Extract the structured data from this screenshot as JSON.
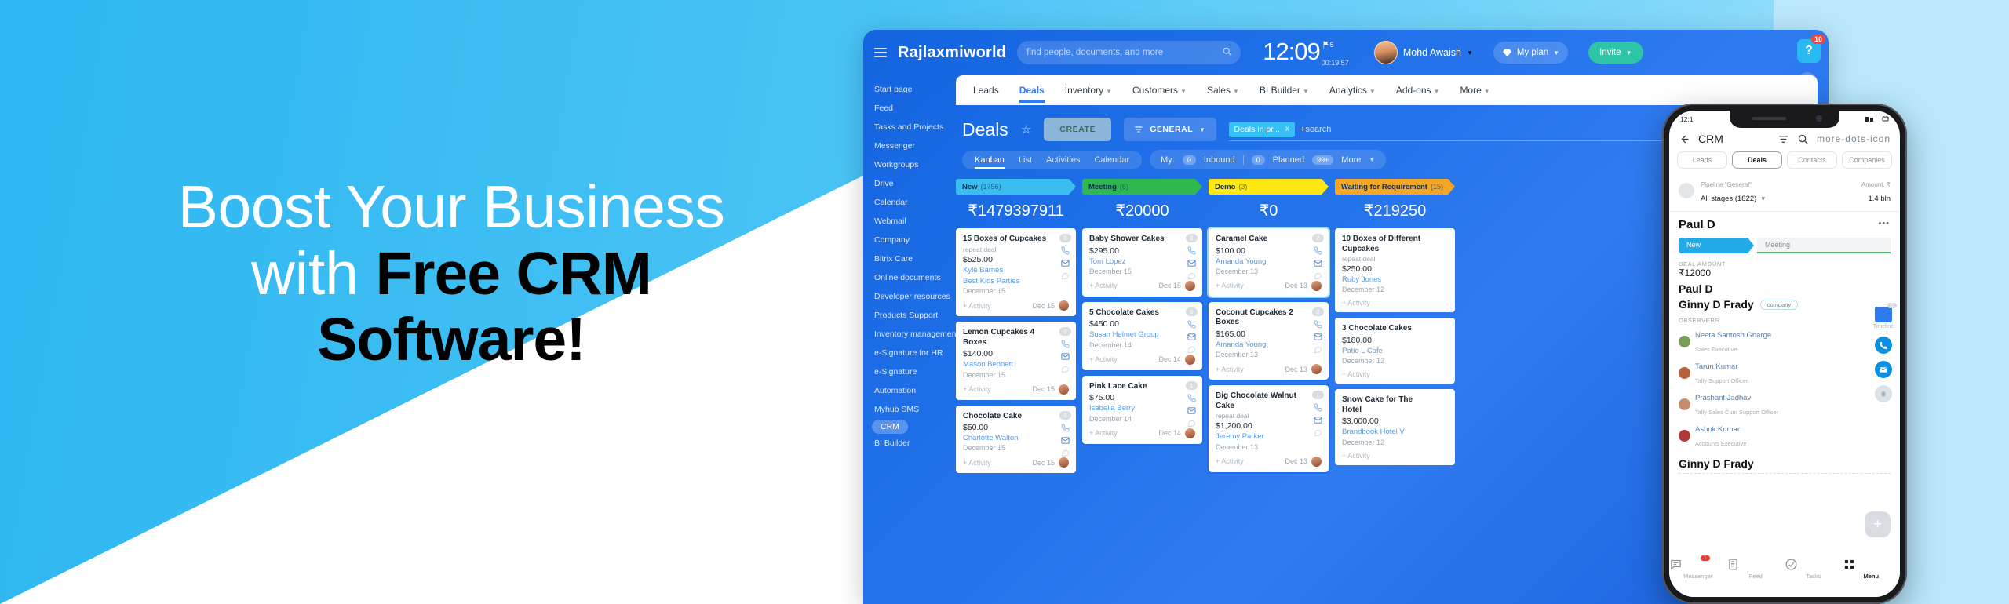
{
  "hero": {
    "line1": "Boost Your Business",
    "line2_light": "with ",
    "line2_bold": "Free CRM",
    "line3_bold": "Software!"
  },
  "app": {
    "topbar": {
      "menu_icon": "hamburger-icon",
      "brand": "Rajlaxmiworld",
      "search_placeholder": "find people, documents, and more",
      "search_icon": "search-icon",
      "clock": "12:09",
      "flag_count": "5",
      "stopwatch": "00:19:57",
      "user_name": "Mohd Awaish",
      "my_plan": "My plan",
      "invite": "Invite",
      "help_icon": "question-mark-icon",
      "help_badge": "10",
      "refresh_icon": "refresh-icon"
    },
    "sidebar": [
      {
        "label": "Start page",
        "active": false
      },
      {
        "label": "Feed",
        "active": false
      },
      {
        "label": "Tasks and Projects",
        "active": false
      },
      {
        "label": "Messenger",
        "active": false
      },
      {
        "label": "Workgroups",
        "active": false
      },
      {
        "label": "Drive",
        "active": false
      },
      {
        "label": "Calendar",
        "active": false
      },
      {
        "label": "Webmail",
        "active": false
      },
      {
        "label": "Company",
        "active": false
      },
      {
        "label": "Bitrix Care",
        "active": false
      },
      {
        "label": "Online documents",
        "active": false
      },
      {
        "label": "Developer resources",
        "active": false
      },
      {
        "label": "Products Support",
        "active": false
      },
      {
        "label": "Inventory management",
        "active": false
      },
      {
        "label": "e-Signature for HR",
        "active": false
      },
      {
        "label": "e-Signature",
        "active": false
      },
      {
        "label": "Automation",
        "active": false
      },
      {
        "label": "Myhub SMS",
        "active": false
      },
      {
        "label": "CRM",
        "active": true
      },
      {
        "label": "BI Builder",
        "active": false
      }
    ],
    "nav": [
      {
        "label": "Leads",
        "caret": false,
        "selected": false
      },
      {
        "label": "Deals",
        "caret": false,
        "selected": true
      },
      {
        "label": "Inventory",
        "caret": true,
        "selected": false
      },
      {
        "label": "Customers",
        "caret": true,
        "selected": false
      },
      {
        "label": "Sales",
        "caret": true,
        "selected": false
      },
      {
        "label": "BI Builder",
        "caret": true,
        "selected": false
      },
      {
        "label": "Analytics",
        "caret": true,
        "selected": false
      },
      {
        "label": "Add-ons",
        "caret": true,
        "selected": false
      },
      {
        "label": "More",
        "caret": true,
        "selected": false
      }
    ],
    "deals_toolbar": {
      "title": "Deals",
      "star_icon": "star-icon",
      "create": "CREATE",
      "filter_icon": "filter-icon",
      "general": "GENERAL",
      "chip": "Deals in pr...",
      "chip_close": "x",
      "plus": "+",
      "search_placeholder": "search"
    },
    "view_tabs": [
      {
        "label": "Kanban",
        "selected": true
      },
      {
        "label": "List",
        "selected": false
      },
      {
        "label": "Activities",
        "selected": false
      },
      {
        "label": "Calendar",
        "selected": false
      }
    ],
    "counters": {
      "my_label": "My:",
      "inbound_count": "0",
      "inbound_label": "Inbound",
      "planned_count": "0",
      "planned_label": "Planned",
      "more_count": "99+",
      "more_label": "More"
    },
    "kanban": [
      {
        "stage": "New",
        "count": "(1756)",
        "color": "#3bbdf0",
        "sum": "₹1479397911",
        "cards": [
          {
            "title": "15 Boxes of Cupcakes",
            "sub": "repeat deal",
            "amount": "$525.00",
            "person": "Kyle Barnes",
            "company": "Best Kids Parties",
            "date": "December 15",
            "activity": "+ Activity",
            "foot_date": "Dec 15",
            "badge": "0",
            "selected": false
          },
          {
            "title": "Lemon Cupcakes 4 Boxes",
            "sub": "",
            "amount": "$140.00",
            "person": "Mason Bennett",
            "company": "",
            "date": "December 15",
            "activity": "+ Activity",
            "foot_date": "Dec 15",
            "badge": "0",
            "selected": false
          },
          {
            "title": "Chocolate Cake",
            "sub": "",
            "amount": "$50.00",
            "person": "Charlotte Walton",
            "company": "",
            "date": "December 15",
            "activity": "+ Activity",
            "foot_date": "Dec 15",
            "badge": "0",
            "selected": false
          }
        ]
      },
      {
        "stage": "Meeting",
        "count": "(6)",
        "color": "#2eb84f",
        "sum": "₹20000",
        "cards": [
          {
            "title": "Baby Shower Cakes",
            "sub": "",
            "amount": "$295.00",
            "person": "Tom Lopez",
            "company": "",
            "date": "December 15",
            "activity": "+ Activity",
            "foot_date": "Dec 15",
            "badge": "0",
            "selected": false
          },
          {
            "title": "5 Chocolate Cakes",
            "sub": "",
            "amount": "$450.00",
            "person": "Susan Helmet Group",
            "company": "",
            "date": "December 14",
            "activity": "+ Activity",
            "foot_date": "Dec 14",
            "badge": "0",
            "selected": true
          },
          {
            "title": "Pink Lace Cake",
            "sub": "",
            "amount": "$75.00",
            "person": "Isabella Berry",
            "company": "",
            "date": "December 14",
            "activity": "+ Activity",
            "foot_date": "Dec 14",
            "badge": "1",
            "selected": true
          }
        ]
      },
      {
        "stage": "Demo",
        "count": "(3)",
        "color": "#ffe712",
        "sum": "₹0",
        "cards": [
          {
            "title": "Caramel Cake",
            "sub": "",
            "amount": "$100.00",
            "person": "Amanda Young",
            "company": "",
            "date": "December 13",
            "activity": "+ Activity",
            "foot_date": "Dec 13",
            "badge": "2",
            "selected": false
          },
          {
            "title": "Coconut Cupcakes 2 Boxes",
            "sub": "",
            "amount": "$165.00",
            "person": "Amanda Young",
            "company": "",
            "date": "December 13",
            "activity": "+ Activity",
            "foot_date": "Dec 13",
            "badge": "0",
            "selected": true
          },
          {
            "title": "Big Chocolate Walnut Cake",
            "sub": "repeat deal",
            "amount": "$1,200.00",
            "person": "Jeremy Parker",
            "company": "",
            "date": "December 13",
            "activity": "+ Activity",
            "foot_date": "Dec 13",
            "badge": "1",
            "selected": true
          }
        ]
      },
      {
        "stage": "Waiting for Requirement",
        "count": "(15)",
        "color": "#f5a623",
        "sum": "₹219250",
        "cards": [
          {
            "title": "10 Boxes of Different Cupcakes",
            "sub": "repeat deal",
            "amount": "$250.00",
            "person": "Ruby Jones",
            "company": "",
            "date": "December 12",
            "activity": "+ Activity",
            "foot_date": "",
            "badge": "",
            "selected": false
          },
          {
            "title": "3 Chocolate Cakes",
            "sub": "",
            "amount": "$180.00",
            "person": "Patio L Cafe",
            "company": "",
            "date": "December 12",
            "activity": "+ Activity",
            "foot_date": "",
            "badge": "",
            "selected": false
          },
          {
            "title": "Snow Cake for The Hotel",
            "sub": "",
            "amount": "$3,000.00",
            "person": "Brandbook Hotel V",
            "company": "",
            "date": "December 12",
            "activity": "+ Activity",
            "foot_date": "",
            "badge": "",
            "selected": false
          }
        ]
      }
    ]
  },
  "phone": {
    "status_time": "12:1",
    "back_icon": "back-arrow-icon",
    "title": "CRM",
    "filter_icon": "filter-icon",
    "search_icon": "search-icon",
    "more_icon": "more-dots-icon",
    "tabs": [
      {
        "label": "Leads",
        "selected": false
      },
      {
        "label": "Deals",
        "selected": true
      },
      {
        "label": "Contacts",
        "selected": false
      },
      {
        "label": "Companies",
        "selected": false
      }
    ],
    "pipeline_label": "Pipeline \"General\"",
    "pipeline_value": "All stages (1822)",
    "amount_label": "Amount, ₹",
    "amount_value": "1.4 bln",
    "deal_name": "Paul D",
    "deal_more": "•••",
    "stage_current": "New",
    "stage_next": "Meeting",
    "deal_amount_label": "DEAL AMOUNT",
    "deal_amount": "₹12000",
    "contact_name": "Paul D",
    "company_name": "Ginny D Frady",
    "company_tag": "company",
    "timeline_label": "Timeline",
    "timeline_badge": "0",
    "observers_label": "OBSERVERS",
    "observers": [
      {
        "name": "Neeta Santosh Gharge",
        "role": "Sales Executive",
        "color": "#7a9e55"
      },
      {
        "name": "Tarun Kumar",
        "role": "Tally Support Officer",
        "color": "#b5623d"
      },
      {
        "name": "Prashant Jadhav",
        "role": "Tally Sales Cum Support Officer",
        "color": "#c98c6b"
      },
      {
        "name": "Ashok Kumar",
        "role": "Accounts Executive",
        "color": "#b03a3a"
      }
    ],
    "bottom_name": "Ginny D Frady",
    "fab": "+",
    "nav": [
      {
        "label": "Messenger",
        "icon": "chat-icon",
        "badge": "1",
        "selected": false
      },
      {
        "label": "Feed",
        "icon": "feed-icon",
        "badge": "",
        "selected": false
      },
      {
        "label": "Tasks",
        "icon": "check-circle-icon",
        "badge": "",
        "selected": false
      },
      {
        "label": "Menu",
        "icon": "grid-icon",
        "badge": "",
        "selected": true
      }
    ]
  }
}
